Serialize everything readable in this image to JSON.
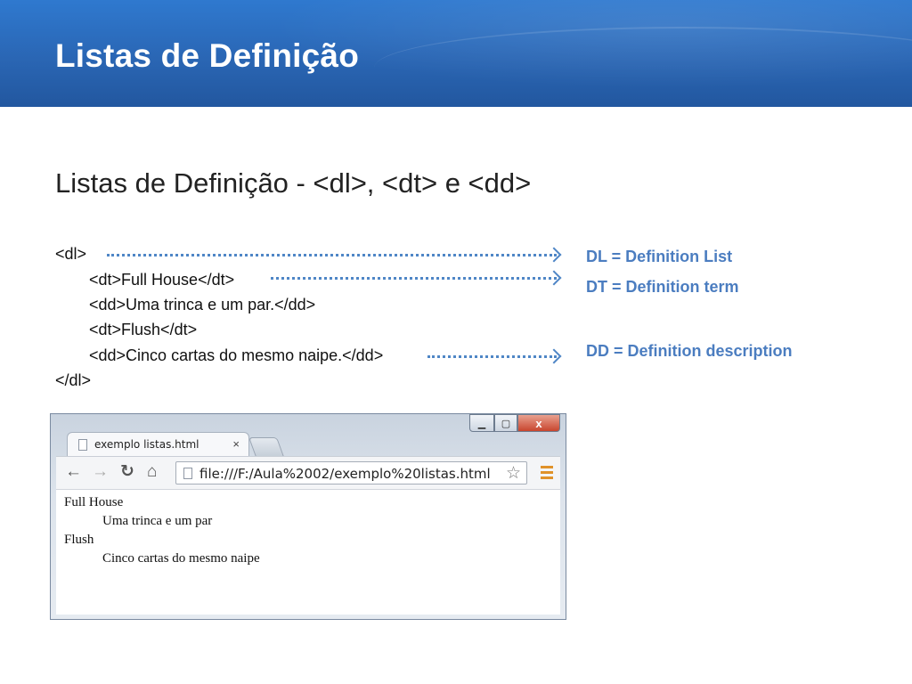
{
  "slide": {
    "title": "Listas de Definição",
    "subtitle": "Listas de Definição - <dl>, <dt> e <dd>"
  },
  "code": {
    "lines": [
      "<dl>",
      "<dt>Full House</dt>",
      "<dd>Uma trinca e um par.</dd>",
      "<dt>Flush</dt>",
      "<dd>Cinco cartas do mesmo naipe.</dd>",
      "</dl>"
    ]
  },
  "notes": {
    "dl": "DL = Definition List",
    "dt": "DT = Definition term",
    "dd": "DD = Definition description"
  },
  "colors": {
    "title_bar": "#2a66b4",
    "note_text": "#4b7dc0",
    "arrow": "#4f86c6"
  },
  "browser": {
    "tab_label": "exemplo listas.html",
    "tab_close": "×",
    "url": "file:///F:/Aula%2002/exemplo%20listas.html",
    "window_controls": [
      "min-icon",
      "max-icon",
      "close-icon"
    ],
    "nav_icons": [
      "back-arrow-icon",
      "forward-arrow-icon",
      "reload-icon",
      "home-icon"
    ],
    "content": {
      "dt1": "Full House",
      "dd1": "Uma trinca e um par",
      "dt2": "Flush",
      "dd2": "Cinco cartas do mesmo naipe"
    }
  }
}
